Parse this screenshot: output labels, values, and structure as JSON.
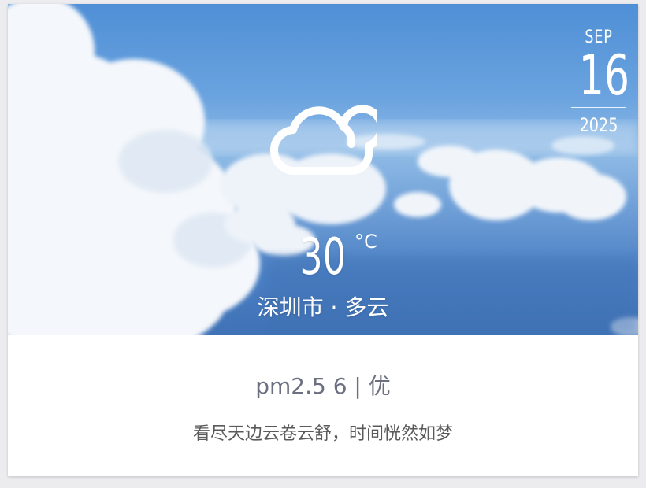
{
  "date": {
    "month": "SEP",
    "day": "16",
    "year": "2025"
  },
  "weather": {
    "icon": "cloudy-icon",
    "temperature": "30",
    "unit": "°C",
    "city": "深圳市",
    "separator": " · ",
    "condition": "多云"
  },
  "air": {
    "text": "pm2.5 6 | 优"
  },
  "quote": {
    "text": "看尽天边云卷云舒，时间恍然如梦"
  },
  "colors": {
    "sky": "#5b94d8",
    "text_muted": "#6c6f80"
  }
}
